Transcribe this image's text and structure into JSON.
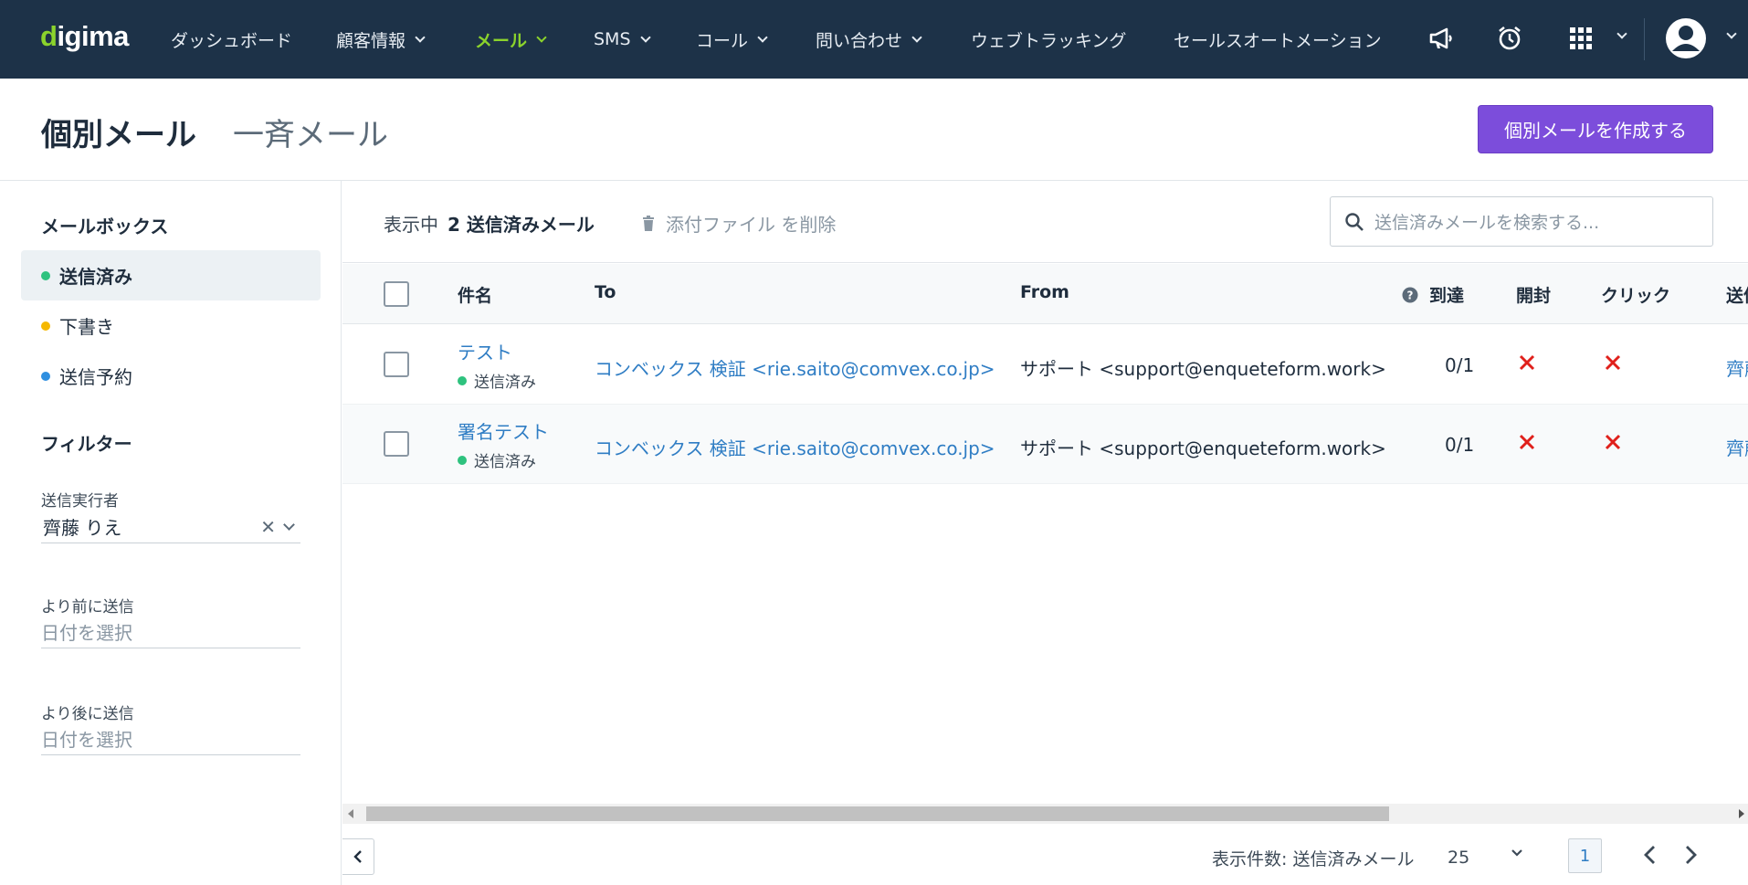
{
  "nav": {
    "logo_main": "igima",
    "logo_initial": "d",
    "items": [
      {
        "label": "ダッシュボード"
      },
      {
        "label": "顧客情報"
      },
      {
        "label": "メール"
      },
      {
        "label": "SMS"
      },
      {
        "label": "コール"
      },
      {
        "label": "問い合わせ"
      },
      {
        "label": "ウェブトラッキング"
      },
      {
        "label": "セールスオートメーション"
      }
    ],
    "icons": [
      "megaphone-icon",
      "alarm-clock-icon",
      "apps-grid-icon",
      "user-avatar-icon"
    ],
    "bg_color": "#1d3248",
    "active_color": "#8bd32c"
  },
  "header": {
    "tab_individual": "個別メール",
    "tab_bulk": "一斉メール",
    "create_button": "個別メールを作成する",
    "accent_color": "#7c4ddb"
  },
  "sidebar": {
    "mailbox_heading": "メールボックス",
    "mailboxes": [
      {
        "label": "送信済み",
        "color": "#2ec27e"
      },
      {
        "label": "下書き",
        "color": "#f5b800"
      },
      {
        "label": "送信予約",
        "color": "#2f8fe0"
      }
    ],
    "filter_heading": "フィルター",
    "sender_label": "送信実行者",
    "sender_value": "齊藤 りえ",
    "before_label": "より前に送信",
    "before_placeholder": "日付を選択",
    "after_label": "より後に送信",
    "after_placeholder": "日付を選択"
  },
  "toolbar": {
    "showing_prefix": "表示中",
    "showing_value": "2 送信済みメール",
    "delete_attachments": "添付ファイル を削除",
    "search_placeholder": "送信済みメールを検索する..."
  },
  "table": {
    "columns": {
      "subject": "件名",
      "to": "To",
      "from": "From",
      "delivered": "到達",
      "opened": "開封",
      "clicked": "クリック",
      "sender": "送信"
    },
    "rows": [
      {
        "subject": "テスト",
        "status": "送信済み",
        "to": "コンベックス 検証 <rie.saito@comvex.co.jp>",
        "from": "サポート <support@enqueteform.work>",
        "delivered": "0/1",
        "opened": "×",
        "clicked": "×",
        "sender": "齊藤"
      },
      {
        "subject": "署名テスト",
        "status": "送信済み",
        "to": "コンベックス 検証 <rie.saito@comvex.co.jp>",
        "from": "サポート <support@enqueteform.work>",
        "delivered": "0/1",
        "opened": "×",
        "clicked": "×",
        "sender": "齊藤"
      }
    ]
  },
  "pagination": {
    "per_page_label": "表示件数: 送信済みメール",
    "per_page_value": "25",
    "current_page": "1"
  }
}
